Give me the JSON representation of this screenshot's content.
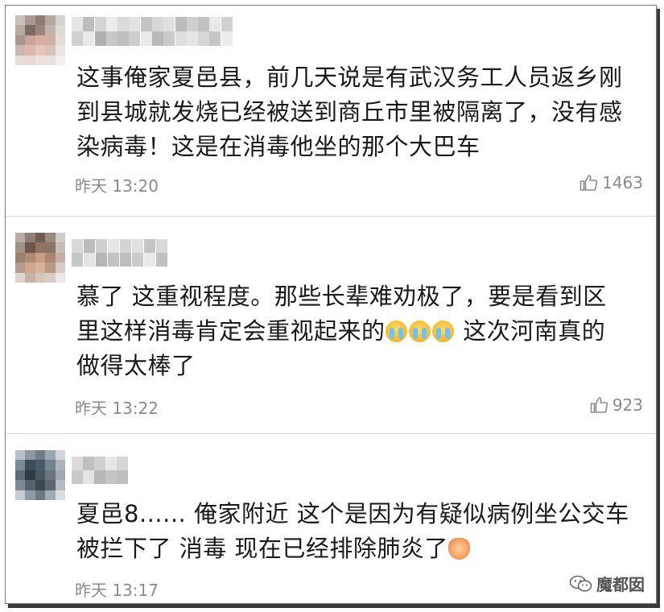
{
  "comments": [
    {
      "content_lines": [
        "这事俺家夏邑县，前几天说是有武汉务工人员返乡刚",
        "到县城就发烧已经被送到商丘市里被隔离了，没有感",
        "染病毒！这是在消毒他坐的那个大巴车"
      ],
      "time": "昨天 13:20",
      "likes": "1463"
    },
    {
      "content_lines": [
        "慕了 这重视程度。那些长辈难劝极了，要是看到区",
        "里这样消毒肯定会重视起来的",
        " 这次河南真的",
        "做得太棒了"
      ],
      "time": "昨天 13:22",
      "likes": "923"
    },
    {
      "content_lines": [
        "夏邑8...... 俺家附近 这个是因为有疑似病例坐公交车",
        "被拦下了 消毒 现在已经排除肺炎了"
      ],
      "time": "昨天 13:17"
    }
  ],
  "watermark": "魔都囡",
  "icons": {
    "like": "thumbs-up-icon",
    "watermark": "wechat-icon",
    "emoji_cry": "loudly-crying-emoji",
    "emoji_clap": "clapping-hands-emoji"
  }
}
